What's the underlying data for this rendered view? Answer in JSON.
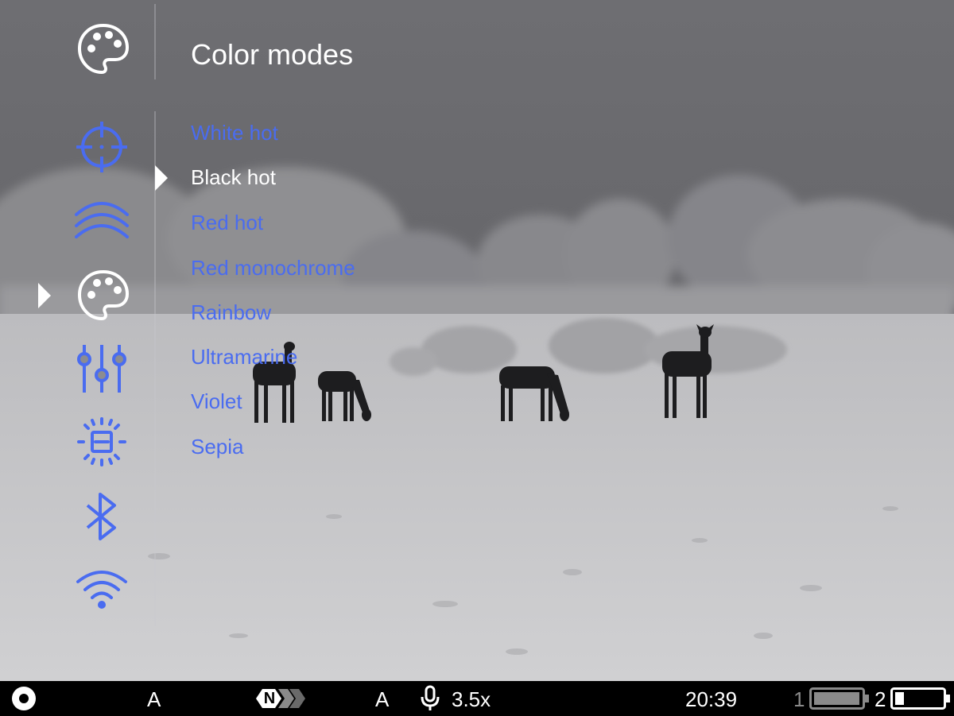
{
  "menu": {
    "title": "Color modes",
    "items": [
      {
        "label": "White hot",
        "selected": false
      },
      {
        "label": "Black hot",
        "selected": true
      },
      {
        "label": "Red hot",
        "selected": false
      },
      {
        "label": "Red monochrome",
        "selected": false
      },
      {
        "label": "Rainbow",
        "selected": false
      },
      {
        "label": "Ultramarine",
        "selected": false
      },
      {
        "label": "Violet",
        "selected": false
      },
      {
        "label": "Sepia",
        "selected": false
      }
    ]
  },
  "sidebar": {
    "header_icon": "palette-icon",
    "items": [
      {
        "icon": "crosshair-icon",
        "active": false
      },
      {
        "icon": "waves-icon",
        "active": false
      },
      {
        "icon": "palette-icon",
        "active": true
      },
      {
        "icon": "sliders-icon",
        "active": false
      },
      {
        "icon": "brightness-icon",
        "active": false
      },
      {
        "icon": "bluetooth-icon",
        "active": false
      },
      {
        "icon": "wifi-icon",
        "active": false
      }
    ]
  },
  "statusbar": {
    "record_icon": "record-icon",
    "mode_a1": "A",
    "nfc_badge": "N",
    "mode_a2": "A",
    "microphone_icon": "microphone-icon",
    "zoom": "3.5x",
    "time": "20:39",
    "battery1_label": "1",
    "battery2_label": "2",
    "battery1_level": 1.0,
    "battery2_level": 0.2
  },
  "colors": {
    "accent_blue": "#4a6cf0",
    "text_white": "#ffffff",
    "dim_gray": "#8a8a8a"
  }
}
